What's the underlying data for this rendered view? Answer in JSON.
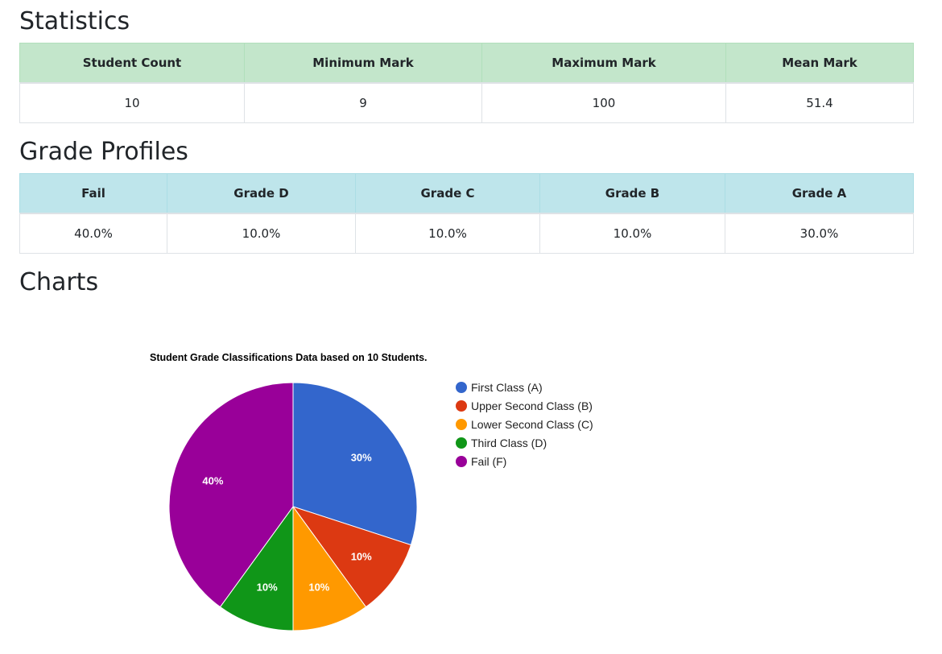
{
  "statistics": {
    "title": "Statistics",
    "headers": [
      "Student Count",
      "Minimum Mark",
      "Maximum Mark",
      "Mean Mark"
    ],
    "values": [
      "10",
      "9",
      "100",
      "51.4"
    ]
  },
  "grade_profiles": {
    "title": "Grade Profiles",
    "headers": [
      "Fail",
      "Grade D",
      "Grade C",
      "Grade B",
      "Grade A"
    ],
    "values": [
      "40.0%",
      "10.0%",
      "10.0%",
      "10.0%",
      "30.0%"
    ]
  },
  "charts": {
    "title": "Charts"
  },
  "chart_data": {
    "type": "pie",
    "title": "Student Grade Classifications Data based on 10 Students.",
    "legend_position": "right",
    "slices": [
      {
        "label": "First Class (A)",
        "value": 30,
        "display": "30%",
        "color": "#3366cc"
      },
      {
        "label": "Upper Second Class (B)",
        "value": 10,
        "display": "10%",
        "color": "#dc3912"
      },
      {
        "label": "Lower Second Class (C)",
        "value": 10,
        "display": "10%",
        "color": "#ff9900"
      },
      {
        "label": "Third Class (D)",
        "value": 10,
        "display": "10%",
        "color": "#109618"
      },
      {
        "label": "Fail (F)",
        "value": 40,
        "display": "40%",
        "color": "#990099"
      }
    ]
  }
}
